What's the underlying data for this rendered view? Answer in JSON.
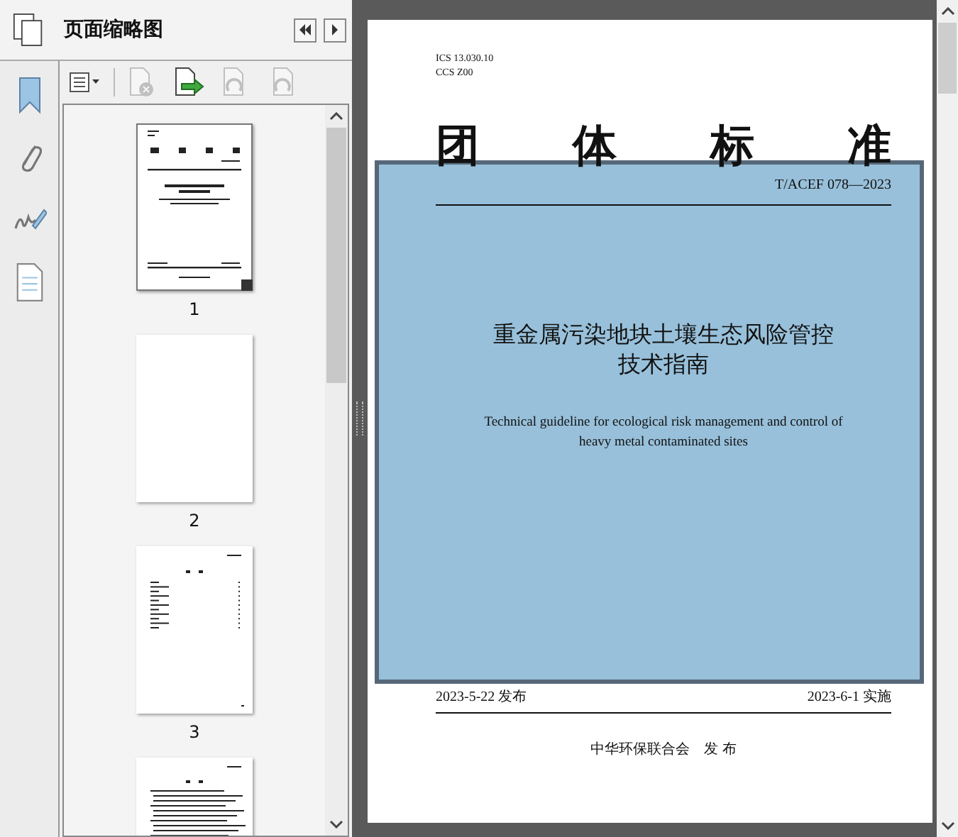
{
  "panel": {
    "title": "页面缩略图"
  },
  "toolbar": [
    {
      "kind": "options",
      "disabled": false
    },
    {
      "kind": "delete",
      "disabled": true
    },
    {
      "kind": "insert",
      "disabled": false
    },
    {
      "kind": "rotate-left",
      "disabled": true
    },
    {
      "kind": "rotate-right",
      "disabled": true
    }
  ],
  "thumbnails": [
    {
      "label": "1",
      "kind": "cover",
      "current": true
    },
    {
      "label": "2",
      "kind": "blank",
      "current": false
    },
    {
      "label": "3",
      "kind": "contents",
      "current": false
    },
    {
      "kind": "text",
      "current": false
    }
  ],
  "document": {
    "header": [
      "ICS 13.030.10",
      "CCS Z00"
    ],
    "heading": [
      "团",
      "体",
      "标",
      "准"
    ],
    "code": "T/ACEF 078—2023",
    "title": [
      "重金属污染地块土壤生态风险管控",
      "技术指南"
    ],
    "subtitle": [
      "Technical guideline for ecological risk management and control of",
      "heavy metal contaminated sites"
    ],
    "issued": "2023-5-22 发布",
    "effective": "2023-6-1 实施",
    "publisher": "中华环保联合会　发 布"
  }
}
